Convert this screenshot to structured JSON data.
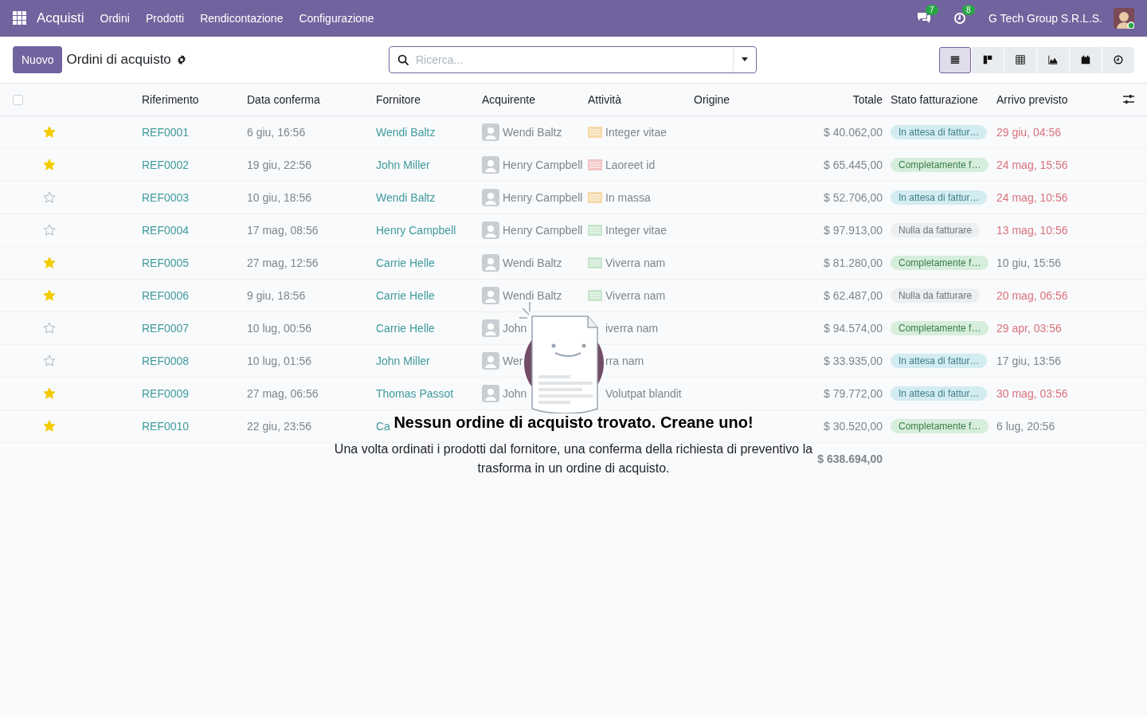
{
  "navbar": {
    "app_name": "Acquisti",
    "menu": [
      "Ordini",
      "Prodotti",
      "Rendicontazione",
      "Configurazione"
    ],
    "messages_count": "7",
    "activities_count": "8",
    "company": "G Tech Group S.R.L.S."
  },
  "control_panel": {
    "new_button": "Nuovo",
    "title": "Ordini di acquisto",
    "search": {
      "placeholder": "Ricerca..."
    },
    "views": [
      {
        "kind": "list",
        "selected": true
      },
      {
        "kind": "kanban",
        "selected": false
      },
      {
        "kind": "pivot",
        "selected": false
      },
      {
        "kind": "graph",
        "selected": false
      },
      {
        "kind": "calendar",
        "selected": false
      },
      {
        "kind": "activity",
        "selected": false
      }
    ]
  },
  "table": {
    "select_all_checked": false,
    "columns": [
      "Riferimento",
      "Data conferma",
      "Fornitore",
      "Acquirente",
      "Attività",
      "Origine",
      "Totale",
      "Stato fatturazione",
      "Arrivo previsto"
    ],
    "rows": [
      {
        "starred": true,
        "reference": "REF0001",
        "date": "6 giu, 16:56",
        "supplier": "Wendi Baltz",
        "buyer": "Wendi Baltz",
        "activity": {
          "label": "Integer vitae",
          "color": "#f5d9a8"
        },
        "total": "$ 40.062,00",
        "status": {
          "label": "In attesa di fattur…",
          "kind": "waiting"
        },
        "arrival": "29 giu, 04:56",
        "overdue": true
      },
      {
        "starred": true,
        "reference": "REF0002",
        "date": "19 giu, 22:56",
        "supplier": "John Miller",
        "buyer": "Henry Campbell",
        "activity": {
          "label": "Laoreet id",
          "color": "#f2c4c4"
        },
        "total": "$ 65.445,00",
        "status": {
          "label": "Completamente f…",
          "kind": "invoiced"
        },
        "arrival": "24 mag, 15:56",
        "overdue": true
      },
      {
        "starred": false,
        "reference": "REF0003",
        "date": "10 giu, 18:56",
        "supplier": "Wendi Baltz",
        "buyer": "Henry Campbell",
        "activity": {
          "label": "In massa",
          "color": "#f5d9a8"
        },
        "total": "$ 52.706,00",
        "status": {
          "label": "In attesa di fattur…",
          "kind": "waiting"
        },
        "arrival": "24 mag, 10:56",
        "overdue": true
      },
      {
        "starred": false,
        "reference": "REF0004",
        "date": "17 mag, 08:56",
        "supplier": "Henry Campbell",
        "buyer": "Henry Campbell",
        "activity": {
          "label": "Integer vitae",
          "color": "#c8e6cc"
        },
        "total": "$ 97.913,00",
        "status": {
          "label": "Nulla da fatturare",
          "kind": "nothing"
        },
        "arrival": "13 mag, 10:56",
        "overdue": true
      },
      {
        "starred": true,
        "reference": "REF0005",
        "date": "27 mag, 12:56",
        "supplier": "Carrie Helle",
        "buyer": "Wendi Baltz",
        "activity": {
          "label": "Viverra nam",
          "color": "#c8e6cc"
        },
        "total": "$ 81.280,00",
        "status": {
          "label": "Completamente f…",
          "kind": "invoiced"
        },
        "arrival": "10 giu, 15:56",
        "overdue": false
      },
      {
        "starred": true,
        "reference": "REF0006",
        "date": "9 giu, 18:56",
        "supplier": "Carrie Helle",
        "buyer": "Wendi Baltz",
        "activity": {
          "label": "Viverra nam",
          "color": "#c8e6cc"
        },
        "total": "$ 62.487,00",
        "status": {
          "label": "Nulla da fatturare",
          "kind": "nothing"
        },
        "arrival": "20 mag, 06:56",
        "overdue": true
      },
      {
        "starred": false,
        "reference": "REF0007",
        "date": "10 lug, 00:56",
        "supplier": "Carrie Helle",
        "buyer": "John",
        "activity": {
          "label": "iverra nam"
        },
        "total": "$ 94.574,00",
        "status": {
          "label": "Completamente f…",
          "kind": "invoiced"
        },
        "arrival": "29 apr, 03:56",
        "overdue": true
      },
      {
        "starred": false,
        "reference": "REF0008",
        "date": "10 lug, 01:56",
        "supplier": "John Miller",
        "buyer": "Wer",
        "activity": {
          "label": "rra nam"
        },
        "total": "$ 33.935,00",
        "status": {
          "label": "In attesa di fattur…",
          "kind": "waiting"
        },
        "arrival": "17 giu, 13:56",
        "overdue": false
      },
      {
        "starred": true,
        "reference": "REF0009",
        "date": "27 mag, 06:56",
        "supplier": "Thomas Passot",
        "buyer": "John",
        "activity": {
          "label": "Volutpat blandit"
        },
        "total": "$ 79.772,00",
        "status": {
          "label": "In attesa di fattur…",
          "kind": "waiting"
        },
        "arrival": "30 mag, 03:56",
        "overdue": true
      },
      {
        "starred": true,
        "reference": "REF0010",
        "date": "22 giu, 23:56",
        "supplier": "Ca",
        "total": "$ 30.520,00",
        "status": {
          "label": "Completamente f…",
          "kind": "invoiced"
        },
        "arrival": "6 lug, 20:56",
        "overdue": false
      }
    ],
    "sum": "$ 638.694,00"
  },
  "empty_state": {
    "title": "Nessun ordine di acquisto trovato. Creane uno!",
    "text": "Una volta ordinati i prodotti dal fornitore, una conferma della richiesta di preventivo la trasforma in un ordine di acquisto."
  }
}
